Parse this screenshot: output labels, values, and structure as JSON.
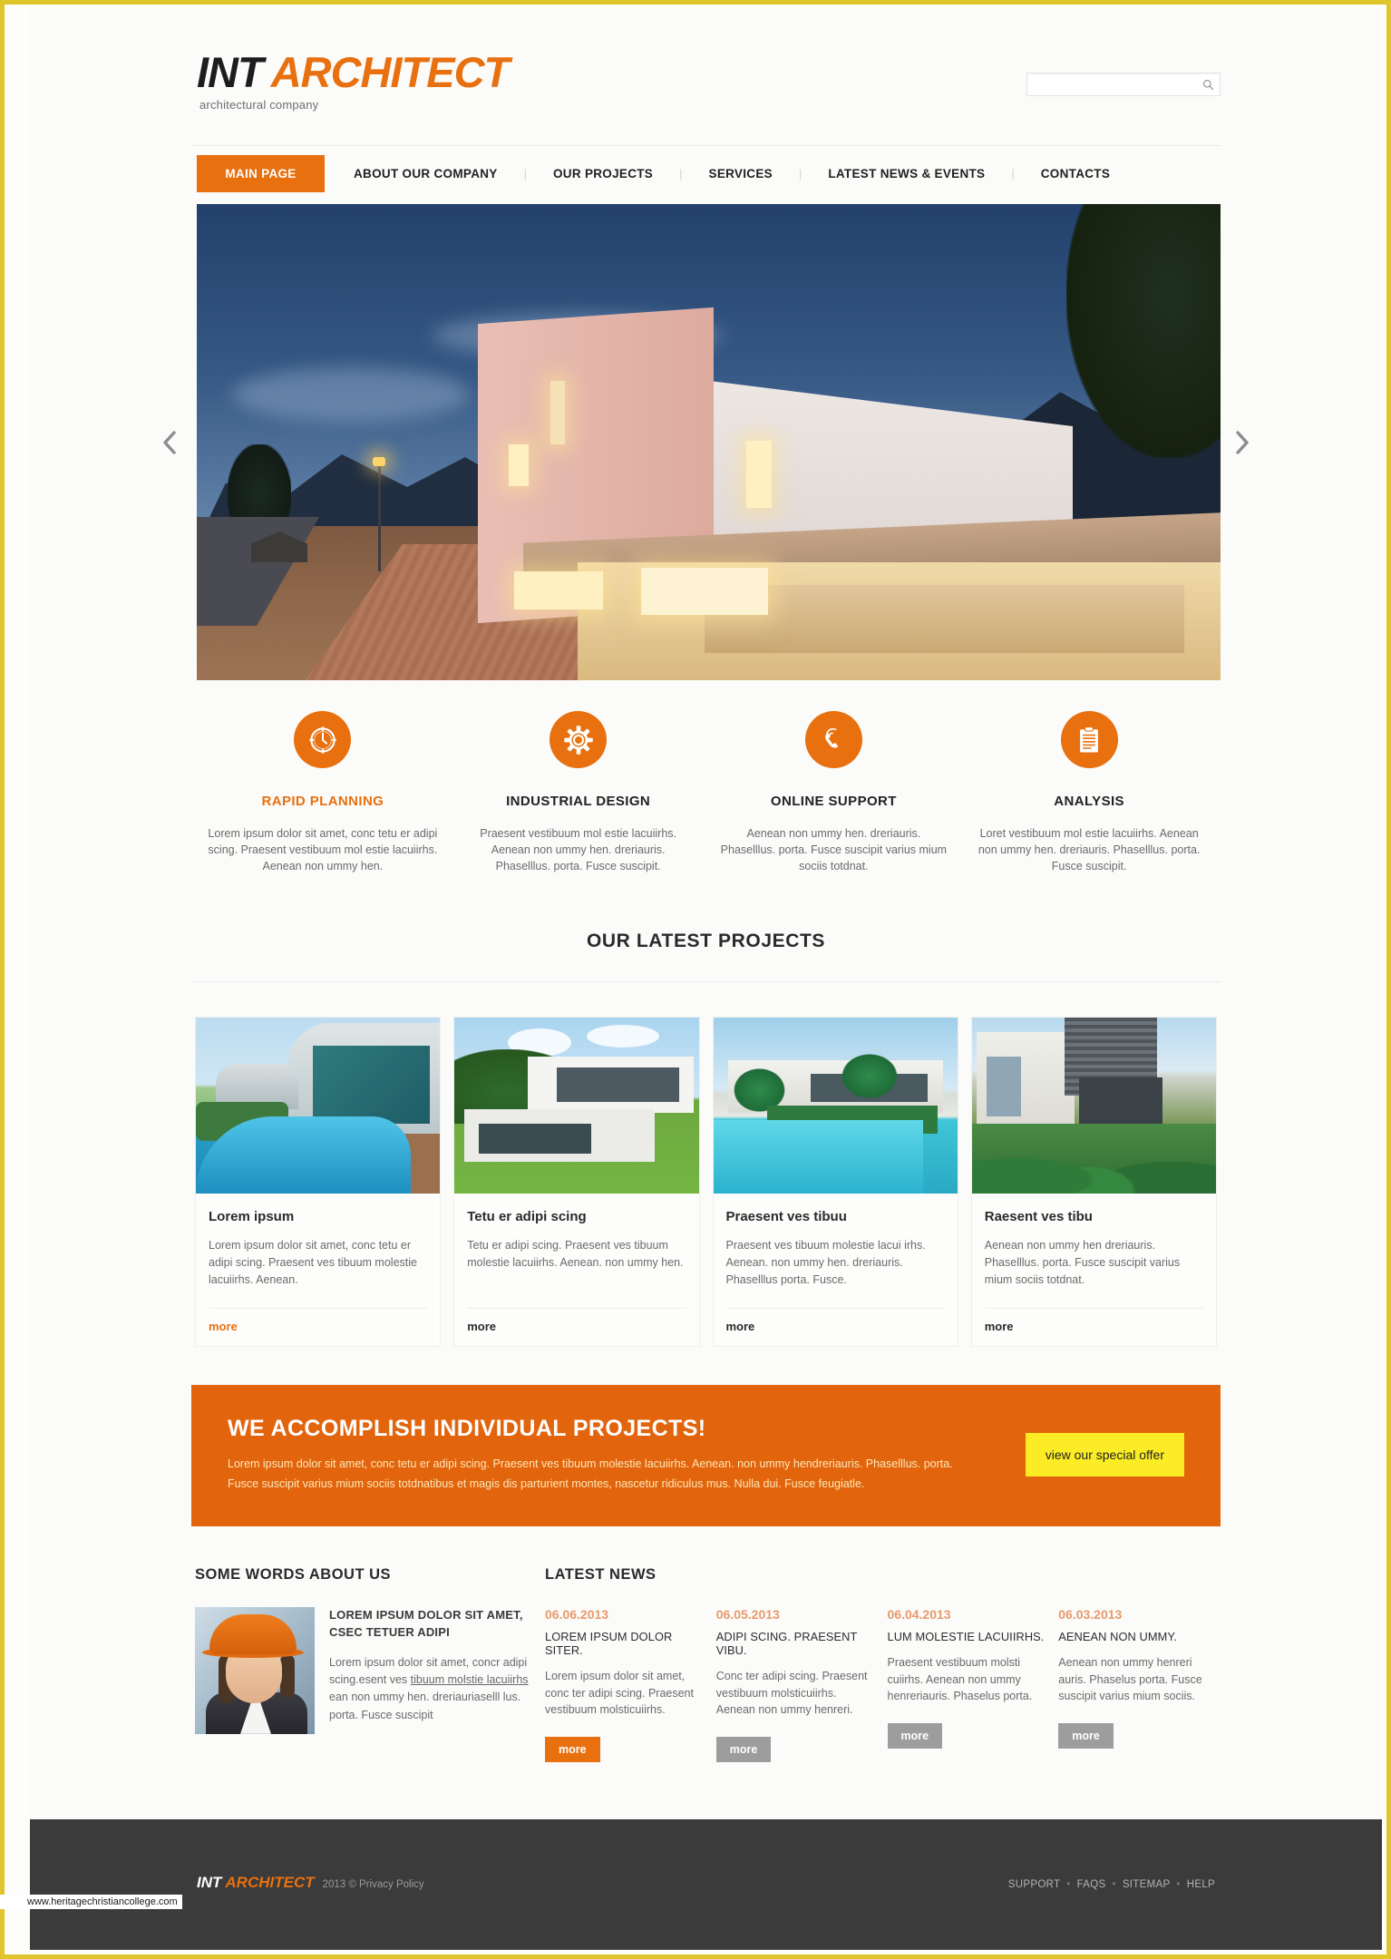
{
  "brand": {
    "name_primary": "INT",
    "name_secondary": "ARCHITECT",
    "tagline": "architectural company"
  },
  "search": {
    "value": "",
    "placeholder": "",
    "icon": "search-icon"
  },
  "nav": {
    "active": "MAIN PAGE",
    "items": [
      "ABOUT OUR COMPANY",
      "OUR PROJECTS",
      "SERVICES",
      "LATEST NEWS & EVENTS",
      "CONTACTS"
    ],
    "separator": "|"
  },
  "slider": {
    "prev_icon": "chevron-left-icon",
    "next_icon": "chevron-right-icon",
    "slide_alt": "modern architect house at dusk"
  },
  "features": [
    {
      "icon": "clock-icon",
      "title": "RAPID PLANNING",
      "accent": true,
      "text": "Lorem ipsum dolor sit amet, conc tetu er adipi scing. Praesent vestibuum mol estie lacuiirhs. Aenean non ummy hen."
    },
    {
      "icon": "gear-icon",
      "title": "INDUSTRIAL DESIGN",
      "accent": false,
      "text": "Praesent vestibuum mol estie lacuiirhs. Aenean non ummy hen. dreriauris. Phaselllus. porta. Fusce suscipit."
    },
    {
      "icon": "phone-support-icon",
      "title": "ONLINE SUPPORT",
      "accent": false,
      "text": "Aenean non ummy hen. dreriauris. Phaselllus. porta. Fusce suscipit varius mium sociis totdnat."
    },
    {
      "icon": "clipboard-icon",
      "title": "ANALYSIS",
      "accent": false,
      "text": "Loret vestibuum mol estie lacuiirhs. Aenean non ummy hen. dreriauris. Phaselllus. porta. Fusce suscipit."
    }
  ],
  "projects_section": {
    "title": "OUR LATEST PROJECTS",
    "items": [
      {
        "title": "Lorem ipsum",
        "text": "Lorem ipsum dolor sit amet, conc tetu er adipi scing. Praesent ves tibuum molestie lacuiirhs. Aenean.",
        "more": "more",
        "accent": true
      },
      {
        "title": "Tetu er adipi scing",
        "text": "Tetu er adipi scing. Praesent ves tibuum molestie lacuiirhs. Aenean. non ummy hen.",
        "more": "more",
        "accent": false
      },
      {
        "title": "Praesent ves tibuu",
        "text": "Praesent ves tibuum molestie lacui irhs. Aenean. non ummy hen. dreriauris. Phaselllus porta. Fusce.",
        "more": "more",
        "accent": false
      },
      {
        "title": "Raesent ves tibu",
        "text": "Aenean non ummy hen dreriauris. Phaselllus. porta. Fusce suscipit varius mium sociis totdnat.",
        "more": "more",
        "accent": false
      }
    ]
  },
  "banner": {
    "title": "WE ACCOMPLISH INDIVIDUAL PROJECTS!",
    "text": "Lorem ipsum dolor sit amet, conc tetu er adipi scing. Praesent ves tibuum molestie lacuiirhs. Aenean. non ummy hendreriauris. Phaselllus. porta. Fusce suscipit varius mium sociis totdnatibus et magis dis parturient montes, nascetur ridiculus mus. Nulla dui. Fusce feugiatle.",
    "button": "view our special offer",
    "bg_color": "#e2640c",
    "button_color": "#fbec26"
  },
  "about": {
    "title": "SOME WORDS ABOUT US",
    "photo_alt": "woman engineer with orange hard hat",
    "heading": "LOREM IPSUM DOLOR SIT AMET, CSEC TETUER ADIPI",
    "text_before": "Lorem ipsum dolor sit amet, concr adipi scing.esent ves ",
    "link_text": "tibuum molstie lacuiirhs",
    "text_after": " ean non ummy hen. dreriauriaselll lus. porta. Fusce suscipit"
  },
  "news": {
    "title": "LATEST NEWS",
    "items": [
      {
        "date": "06.06.2013",
        "title": "LOREM IPSUM DOLOR SITER.",
        "text": "Lorem ipsum dolor sit amet, conc ter adipi scing. Praesent vestibuum molsticuiirhs.",
        "button": "more",
        "accent": true
      },
      {
        "date": "06.05.2013",
        "title": "ADIPI SCING. PRAESENT VIBU.",
        "text": "Conc ter adipi scing. Praesent vestibuum molsticuiirhs. Aenean non ummy henreri.",
        "button": "more",
        "accent": false
      },
      {
        "date": "06.04.2013",
        "title": "LUM MOLESTIE LACUIIRHS.",
        "text": "Praesent vestibuum molsti cuiirhs. Aenean non ummy henreriauris. Phaselus porta.",
        "button": "more",
        "accent": false
      },
      {
        "date": "06.03.2013",
        "title": "AENEAN NON UMMY.",
        "text": "Aenean non ummy henreri auris. Phaselus porta. Fusce suscipit varius mium sociis.",
        "button": "more",
        "accent": false
      }
    ]
  },
  "footer": {
    "name_primary": "INT",
    "name_secondary": "ARCHITECT",
    "copyright": "2013 © Privacy Policy",
    "links": [
      "SUPPORT",
      "FAQS",
      "SITEMAP",
      "HELP"
    ],
    "dot": "•",
    "watermark": "www.heritagechristiancollege.com"
  }
}
